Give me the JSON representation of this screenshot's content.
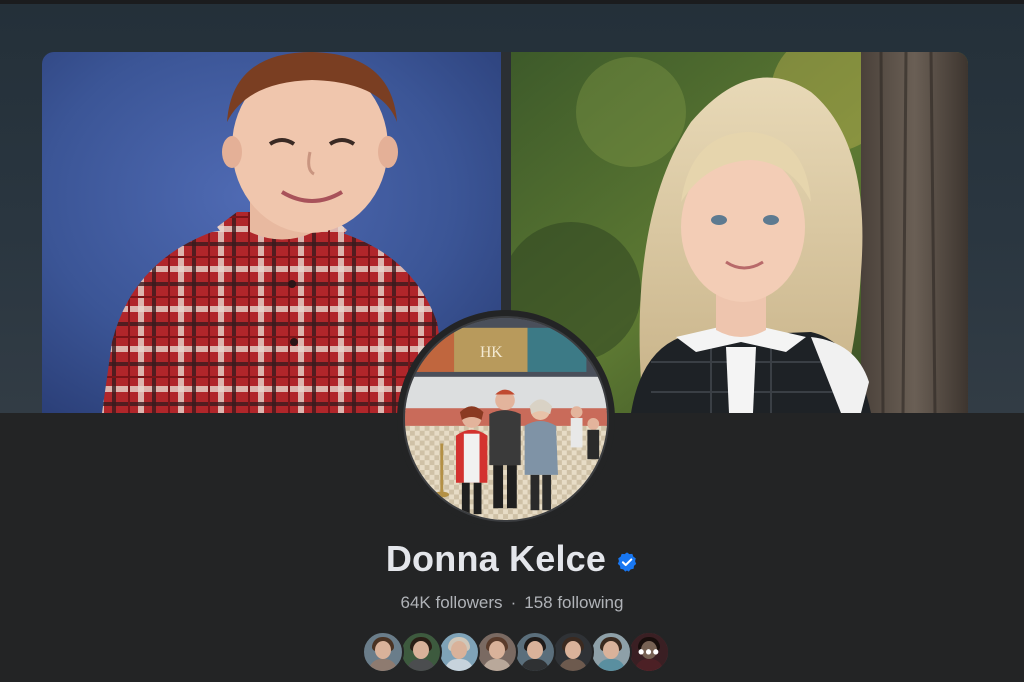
{
  "profile": {
    "name": "Donna Kelce",
    "followers": "64K followers",
    "separator": "·",
    "following": "158 following",
    "verified": true
  },
  "cover": {
    "left_photo": "child-portrait-plaid-shirt",
    "right_photo": "child-portrait-outdoor-tree"
  },
  "avatar": {
    "sign_text": "HK"
  },
  "mutual_friends": [
    {
      "icon": "friend-avatar-1",
      "bg": "#6a7d8a",
      "hair": "#4a3323",
      "body": "#8e7b70"
    },
    {
      "icon": "friend-avatar-2",
      "bg": "#3d5a3e",
      "hair": "#2a1e16",
      "body": "#4b4d4f"
    },
    {
      "icon": "friend-avatar-3",
      "bg": "#7fa3b8",
      "hair": "#d0c7b9",
      "body": "#c7d3dc"
    },
    {
      "icon": "friend-avatar-4",
      "bg": "#7a6a62",
      "hair": "#5a3c2c",
      "body": "#b9a89a"
    },
    {
      "icon": "friend-avatar-5",
      "bg": "#5b6f7c",
      "hair": "#1f1b19",
      "body": "#2f3133"
    },
    {
      "icon": "friend-avatar-6",
      "bg": "#2f3236",
      "hair": "#3b2a20",
      "body": "#6d5a4e"
    },
    {
      "icon": "friend-avatar-7",
      "bg": "#8ea0a8",
      "hair": "#3a2a1f",
      "body": "#5a8fa0"
    },
    {
      "icon": "friend-avatar-8",
      "bg": "#6b3a40",
      "hair": "#2c1a16",
      "body": "#8a3b44"
    }
  ],
  "colors": {
    "background": "#232425",
    "name_text": "#e4e6eb",
    "secondary_text": "#b0b3b8",
    "verified_badge": "#1877f2"
  }
}
